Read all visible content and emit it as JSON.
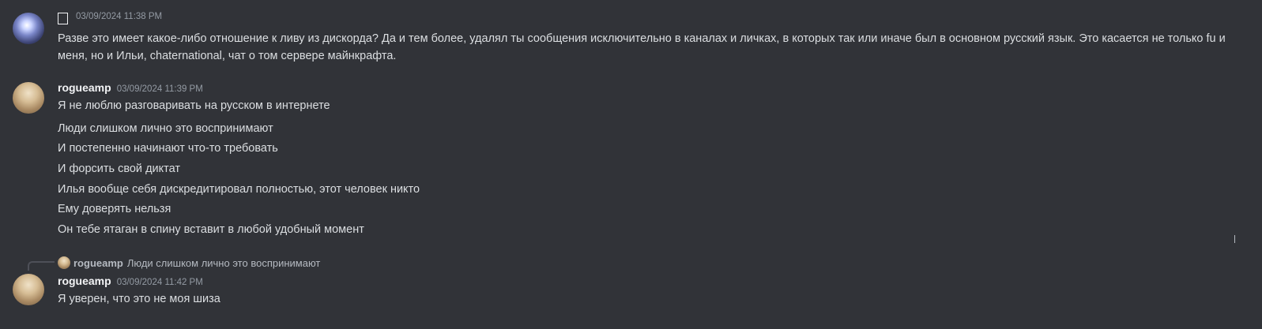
{
  "messages": [
    {
      "author": "",
      "author_glyph": "￼",
      "timestamp": "03/09/2024 11:38 PM",
      "lines": [
        "Разве это имеет какое-либо отношение к ливу из дискорда? Да и тем более, удалял ты сообщения исключительно в каналах и личках, в которых так или иначе был в основном русский язык. Это касается не только fu и меня, но и Ильи, chaternational, чат о том сервере майнкрафта."
      ]
    },
    {
      "author": "rogueamp",
      "timestamp": "03/09/2024 11:39 PM",
      "lines": [
        "Я не люблю разговаривать на русском в интернете",
        "Люди слишком лично это воспринимают",
        "И постепенно начинают что-то требовать",
        "И форсить свой диктат",
        "Илья вообще себя дискредитировал полностью, этот человек никто",
        "Ему доверять нельзя",
        "Он тебе ятаган в спину вставит в любой удобный момент"
      ]
    },
    {
      "reply_to": {
        "author": "rogueamp",
        "text": "Люди слишком лично это воспринимают"
      },
      "author": "rogueamp",
      "timestamp": "03/09/2024 11:42 PM",
      "lines": [
        "Я уверен, что это не моя шиза"
      ]
    }
  ],
  "icons": {
    "avatar_1": "crystal-avatar",
    "avatar_2": "rogueamp-avatar",
    "reply_avatar": "rogueamp-avatar-small"
  }
}
